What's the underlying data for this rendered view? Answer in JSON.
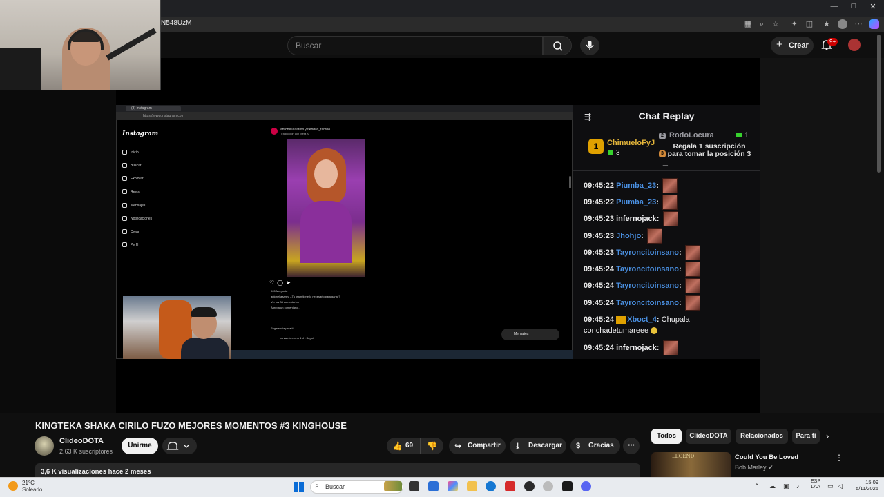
{
  "browser": {
    "url_fragment": "N548UzM",
    "window_controls": [
      "—",
      "□",
      "✕"
    ]
  },
  "yt_header": {
    "search_placeholder": "Buscar",
    "create_label": "Crear",
    "notification_badge": "9+"
  },
  "stream": {
    "instagram": {
      "tab_title": "(3) Instagram",
      "url": "https://www.instagram.com",
      "logo": "Instagram",
      "nav": [
        "Inicio",
        "Buscar",
        "Explorar",
        "Reels",
        "Mensajes",
        "Notificaciones",
        "Crear",
        "Perfil"
      ],
      "post_user": "antonellaaarevi y tiendas_tambo",
      "post_sub": "Traducción con Meta AI",
      "likes": "965 Me gusta",
      "caption": "antonellaaarevi ¿Tu team tiene lo necesario para ganar?",
      "comments": "Ver los 34 comentarios",
      "add_comment": "Agrega un comentario...",
      "suggestions": "Sugerencia para ti",
      "suggested_user": "mnramberson • 1 d • Seguir",
      "messages_label": "Mensajes"
    },
    "chat": {
      "title": "Chat Replay",
      "leaderboard": {
        "first": {
          "rank": "1",
          "name": "ChimueloFyJ",
          "score": "3"
        },
        "second": {
          "rank": "2",
          "name": "RodoLocura",
          "score": "1"
        },
        "third_prompt": "Regala 1 suscripción para tomar la posición 3"
      },
      "messages": [
        {
          "time": "09:45:22",
          "user": "Piumba_23",
          "text": ""
        },
        {
          "time": "09:45:22",
          "user": "Piumba_23",
          "text": ""
        },
        {
          "time": "09:45:23",
          "user": "infernojack",
          "text": ""
        },
        {
          "time": "09:45:23",
          "user": "Jhohjo",
          "text": ""
        },
        {
          "time": "09:45:23",
          "user": "Tayroncitoinsano",
          "text": ""
        },
        {
          "time": "09:45:24",
          "user": "Tayroncitoinsano",
          "text": ""
        },
        {
          "time": "09:45:24",
          "user": "Tayroncitoinsano",
          "text": ""
        },
        {
          "time": "09:45:24",
          "user": "Tayroncitoinsano",
          "text": ""
        },
        {
          "time": "09:45:24",
          "user": "Xboct_4",
          "text": "Chupala"
        },
        {
          "time": "",
          "user": "",
          "text": "conchadetumareee"
        },
        {
          "time": "09:45:24",
          "user": "infernojack",
          "text": ""
        }
      ]
    }
  },
  "video": {
    "title": "KINGTEKA SHAKA CIRILO FUZO MEJORES MOMENTOS #3 KINGHOUSE",
    "channel": "ClideoDOTA",
    "subscribers": "2,63 K suscriptores",
    "join_label": "Unirme",
    "likes": "69",
    "share_label": "Compartir",
    "download_label": "Descargar",
    "thanks_label": "Gracias",
    "more_label": "⋯",
    "stats": "3,6 K visualizaciones  hace 2 meses"
  },
  "related": {
    "chips": [
      "Todos",
      "ClideoDOTA",
      "Relacionados",
      "Para ti"
    ],
    "item": {
      "title": "Could You Be Loved",
      "channel": "Bob Marley",
      "thumb_text": "LEGEND"
    }
  },
  "taskbar": {
    "temperature": "21°C",
    "weather": "Soleado",
    "search": "Buscar",
    "lang_line1": "ESP",
    "lang_line2": "LAA",
    "time": "15:09",
    "date": "5/11/2025"
  },
  "colors": {
    "chat_username": "#4a90e2",
    "leader_gold": "#e0a100",
    "yt_bg": "#0f0f0f",
    "badge_red": "#cc0000"
  }
}
